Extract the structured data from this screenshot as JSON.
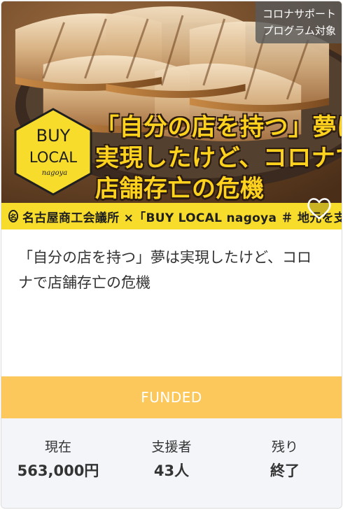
{
  "hero": {
    "image_alt": "焼き餃子",
    "headline_lines": [
      "「自分の店を持つ」夢は",
      "実現したけど、コロナで",
      "店舗存亡の危機"
    ],
    "logo": {
      "line1": "BUY",
      "line2": "LOCAL",
      "line3": "nagoya"
    },
    "band_text": "名古屋商工会議所 ×「BUY LOCAL nagoya ＃ 地元を支えよう」",
    "corner_tag": [
      "コロナサポート",
      "プログラム対象"
    ],
    "favorite_icon": "heart-outline-icon"
  },
  "project": {
    "title": "「自分の店を持つ」夢は実現したけど、コロナで店舗存亡の危機"
  },
  "status": {
    "label": "FUNDED",
    "color": "#fcc85c"
  },
  "stats": [
    {
      "label": "現在",
      "value": "563,000円"
    },
    {
      "label": "支援者",
      "value": "43人"
    },
    {
      "label": "残り",
      "value": "終了"
    }
  ]
}
